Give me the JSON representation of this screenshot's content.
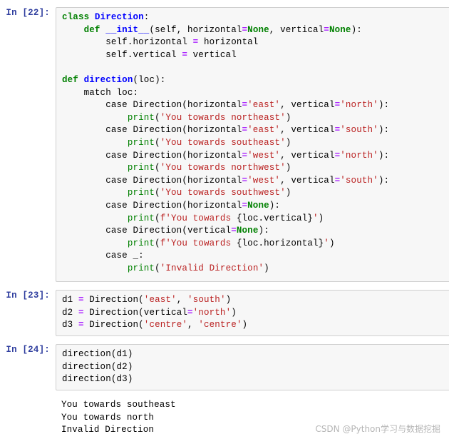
{
  "notebook": {
    "watermark": "CSDN @Python学习与数据挖掘",
    "cells": [
      {
        "prompt": "In [22]:",
        "code_lines": [
          [
            {
              "t": "class ",
              "c": "kw"
            },
            {
              "t": "Direction",
              "c": "fn"
            },
            {
              "t": ":",
              "c": "pl"
            }
          ],
          [
            {
              "t": "    ",
              "c": "pl"
            },
            {
              "t": "def ",
              "c": "kw"
            },
            {
              "t": "__init__",
              "c": "fn"
            },
            {
              "t": "(self, horizontal",
              "c": "pl"
            },
            {
              "t": "=",
              "c": "op"
            },
            {
              "t": "None",
              "c": "kw"
            },
            {
              "t": ", vertical",
              "c": "pl"
            },
            {
              "t": "=",
              "c": "op"
            },
            {
              "t": "None",
              "c": "kw"
            },
            {
              "t": "):",
              "c": "pl"
            }
          ],
          [
            {
              "t": "        self.horizontal ",
              "c": "pl"
            },
            {
              "t": "=",
              "c": "op"
            },
            {
              "t": " horizontal",
              "c": "pl"
            }
          ],
          [
            {
              "t": "        self.vertical ",
              "c": "pl"
            },
            {
              "t": "=",
              "c": "op"
            },
            {
              "t": " vertical",
              "c": "pl"
            }
          ],
          [],
          [
            {
              "t": "def ",
              "c": "kw"
            },
            {
              "t": "direction",
              "c": "fn"
            },
            {
              "t": "(loc):",
              "c": "pl"
            }
          ],
          [
            {
              "t": "    match loc:",
              "c": "pl"
            }
          ],
          [
            {
              "t": "        case Direction(horizontal",
              "c": "pl"
            },
            {
              "t": "=",
              "c": "op"
            },
            {
              "t": "'east'",
              "c": "str"
            },
            {
              "t": ", vertical",
              "c": "pl"
            },
            {
              "t": "=",
              "c": "op"
            },
            {
              "t": "'north'",
              "c": "str"
            },
            {
              "t": "):",
              "c": "pl"
            }
          ],
          [
            {
              "t": "            ",
              "c": "pl"
            },
            {
              "t": "print",
              "c": "bi"
            },
            {
              "t": "(",
              "c": "pl"
            },
            {
              "t": "'You towards northeast'",
              "c": "str"
            },
            {
              "t": ")",
              "c": "pl"
            }
          ],
          [
            {
              "t": "        case Direction(horizontal",
              "c": "pl"
            },
            {
              "t": "=",
              "c": "op"
            },
            {
              "t": "'east'",
              "c": "str"
            },
            {
              "t": ", vertical",
              "c": "pl"
            },
            {
              "t": "=",
              "c": "op"
            },
            {
              "t": "'south'",
              "c": "str"
            },
            {
              "t": "):",
              "c": "pl"
            }
          ],
          [
            {
              "t": "            ",
              "c": "pl"
            },
            {
              "t": "print",
              "c": "bi"
            },
            {
              "t": "(",
              "c": "pl"
            },
            {
              "t": "'You towards southeast'",
              "c": "str"
            },
            {
              "t": ")",
              "c": "pl"
            }
          ],
          [
            {
              "t": "        case Direction(horizontal",
              "c": "pl"
            },
            {
              "t": "=",
              "c": "op"
            },
            {
              "t": "'west'",
              "c": "str"
            },
            {
              "t": ", vertical",
              "c": "pl"
            },
            {
              "t": "=",
              "c": "op"
            },
            {
              "t": "'north'",
              "c": "str"
            },
            {
              "t": "):",
              "c": "pl"
            }
          ],
          [
            {
              "t": "            ",
              "c": "pl"
            },
            {
              "t": "print",
              "c": "bi"
            },
            {
              "t": "(",
              "c": "pl"
            },
            {
              "t": "'You towards northwest'",
              "c": "str"
            },
            {
              "t": ")",
              "c": "pl"
            }
          ],
          [
            {
              "t": "        case Direction(horizontal",
              "c": "pl"
            },
            {
              "t": "=",
              "c": "op"
            },
            {
              "t": "'west'",
              "c": "str"
            },
            {
              "t": ", vertical",
              "c": "pl"
            },
            {
              "t": "=",
              "c": "op"
            },
            {
              "t": "'south'",
              "c": "str"
            },
            {
              "t": "):",
              "c": "pl"
            }
          ],
          [
            {
              "t": "            ",
              "c": "pl"
            },
            {
              "t": "print",
              "c": "bi"
            },
            {
              "t": "(",
              "c": "pl"
            },
            {
              "t": "'You towards southwest'",
              "c": "str"
            },
            {
              "t": ")",
              "c": "pl"
            }
          ],
          [
            {
              "t": "        case Direction(horizontal",
              "c": "pl"
            },
            {
              "t": "=",
              "c": "op"
            },
            {
              "t": "None",
              "c": "kw"
            },
            {
              "t": "):",
              "c": "pl"
            }
          ],
          [
            {
              "t": "            ",
              "c": "pl"
            },
            {
              "t": "print",
              "c": "bi"
            },
            {
              "t": "(",
              "c": "pl"
            },
            {
              "t": "f'You towards ",
              "c": "str"
            },
            {
              "t": "{loc.vertical}",
              "c": "pl"
            },
            {
              "t": "'",
              "c": "str"
            },
            {
              "t": ")",
              "c": "pl"
            }
          ],
          [
            {
              "t": "        case Direction(vertical",
              "c": "pl"
            },
            {
              "t": "=",
              "c": "op"
            },
            {
              "t": "None",
              "c": "kw"
            },
            {
              "t": "):",
              "c": "pl"
            }
          ],
          [
            {
              "t": "            ",
              "c": "pl"
            },
            {
              "t": "print",
              "c": "bi"
            },
            {
              "t": "(",
              "c": "pl"
            },
            {
              "t": "f'You towards ",
              "c": "str"
            },
            {
              "t": "{loc.horizontal}",
              "c": "pl"
            },
            {
              "t": "'",
              "c": "str"
            },
            {
              "t": ")",
              "c": "pl"
            }
          ],
          [
            {
              "t": "        case _:",
              "c": "pl"
            }
          ],
          [
            {
              "t": "            ",
              "c": "pl"
            },
            {
              "t": "print",
              "c": "bi"
            },
            {
              "t": "(",
              "c": "pl"
            },
            {
              "t": "'Invalid Direction'",
              "c": "str"
            },
            {
              "t": ")",
              "c": "pl"
            }
          ]
        ]
      },
      {
        "prompt": "In [23]:",
        "code_lines": [
          [
            {
              "t": "d1 ",
              "c": "pl"
            },
            {
              "t": "=",
              "c": "op"
            },
            {
              "t": " Direction(",
              "c": "pl"
            },
            {
              "t": "'east'",
              "c": "str"
            },
            {
              "t": ", ",
              "c": "pl"
            },
            {
              "t": "'south'",
              "c": "str"
            },
            {
              "t": ")",
              "c": "pl"
            }
          ],
          [
            {
              "t": "d2 ",
              "c": "pl"
            },
            {
              "t": "=",
              "c": "op"
            },
            {
              "t": " Direction(vertical",
              "c": "pl"
            },
            {
              "t": "=",
              "c": "op"
            },
            {
              "t": "'north'",
              "c": "str"
            },
            {
              "t": ")",
              "c": "pl"
            }
          ],
          [
            {
              "t": "d3 ",
              "c": "pl"
            },
            {
              "t": "=",
              "c": "op"
            },
            {
              "t": " Direction(",
              "c": "pl"
            },
            {
              "t": "'centre'",
              "c": "str"
            },
            {
              "t": ", ",
              "c": "pl"
            },
            {
              "t": "'centre'",
              "c": "str"
            },
            {
              "t": ")",
              "c": "pl"
            }
          ]
        ]
      },
      {
        "prompt": "In [24]:",
        "code_lines": [
          [
            {
              "t": "direction(d1)",
              "c": "pl"
            }
          ],
          [
            {
              "t": "direction(d2)",
              "c": "pl"
            }
          ],
          [
            {
              "t": "direction(d3)",
              "c": "pl"
            }
          ]
        ],
        "output_lines": [
          "You towards southeast",
          "You towards north",
          "Invalid Direction"
        ]
      }
    ]
  }
}
